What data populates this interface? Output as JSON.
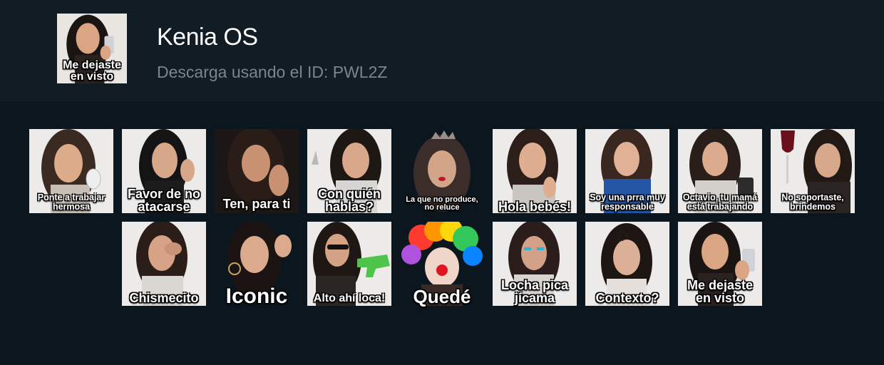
{
  "header": {
    "title": "Kenia OS",
    "subtitle": "Descarga usando el ID: PWL2Z",
    "icon_caption_1": "Me dejaste",
    "icon_caption_2": "en visto"
  },
  "stickers": [
    {
      "l1": "Ponte a trabajar",
      "l2": "hermosa"
    },
    {
      "l1": "Favor de no",
      "l2": "atacarse"
    },
    {
      "l1": "Ten, para ti",
      "l2": ""
    },
    {
      "l1": "Con quién",
      "l2": "hablas?"
    },
    {
      "l1": "La que no produce,",
      "l2": "no reluce"
    },
    {
      "l1": "Hola bebés!",
      "l2": ""
    },
    {
      "l1": "Soy una prra muy",
      "l2": "responsable"
    },
    {
      "l1": "Octavio, tu mamá",
      "l2": "está trabajando"
    },
    {
      "l1": "No soportaste,",
      "l2": "brindemos"
    },
    {
      "l1": "Chismecito",
      "l2": ""
    },
    {
      "l1": "Iconic",
      "l2": ""
    },
    {
      "l1": "Alto ahí loca!",
      "l2": ""
    },
    {
      "l1": "Quedé",
      "l2": ""
    },
    {
      "l1": "Locha pica",
      "l2": "jícama"
    },
    {
      "l1": "Contexto?",
      "l2": ""
    },
    {
      "l1": "Me dejaste",
      "l2": "en visto"
    }
  ],
  "colors": {
    "background": "#0c161f",
    "header_background": "#121c25",
    "title": "#ffffff",
    "subtitle": "#7b858e"
  }
}
